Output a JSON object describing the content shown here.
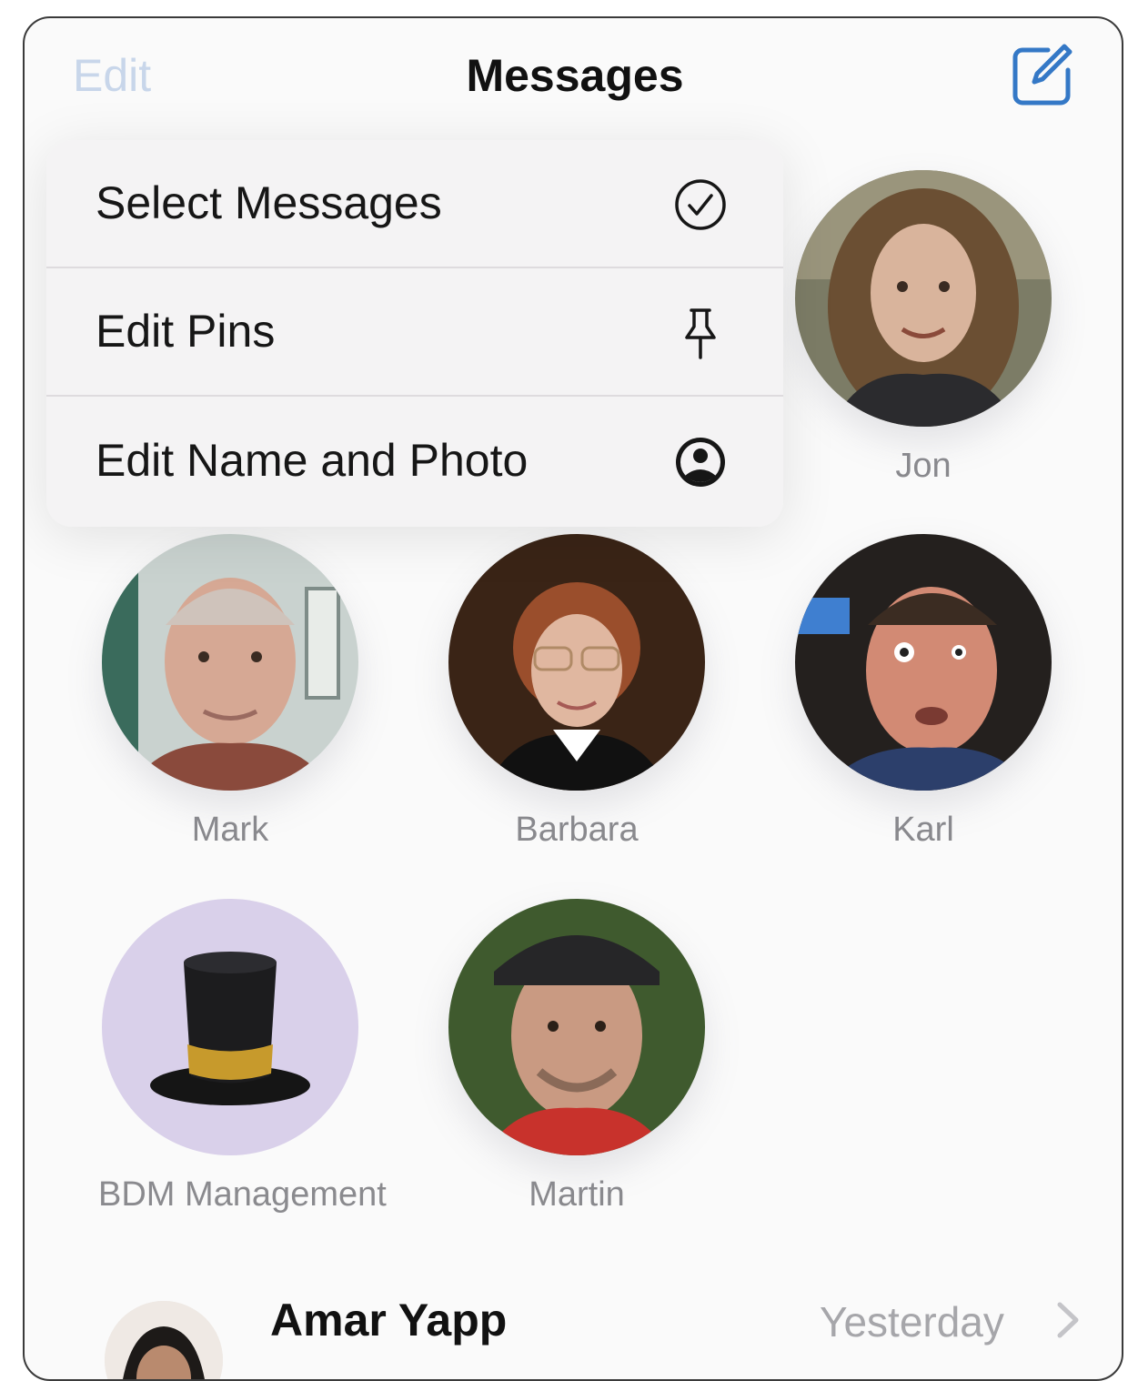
{
  "header": {
    "edit_label": "Edit",
    "title": "Messages",
    "compose_icon": "compose-icon"
  },
  "menu": {
    "items": [
      {
        "label": "Select Messages",
        "icon": "checkmark-circle-icon"
      },
      {
        "label": "Edit Pins",
        "icon": "pin-icon"
      },
      {
        "label": "Edit Name and Photo",
        "icon": "person-circle-icon"
      }
    ]
  },
  "pins": [
    {
      "name": "Jon"
    },
    {
      "name": "Mark"
    },
    {
      "name": "Barbara"
    },
    {
      "name": "Karl"
    },
    {
      "name": "BDM Management"
    },
    {
      "name": "Martin"
    }
  ],
  "list": {
    "rows": [
      {
        "name": "Amar Yapp",
        "time": "Yesterday"
      }
    ]
  },
  "colors": {
    "accent": "#3478c6",
    "edit_disabled": "#c8d6ea",
    "secondary_text": "#8a8a8e"
  }
}
